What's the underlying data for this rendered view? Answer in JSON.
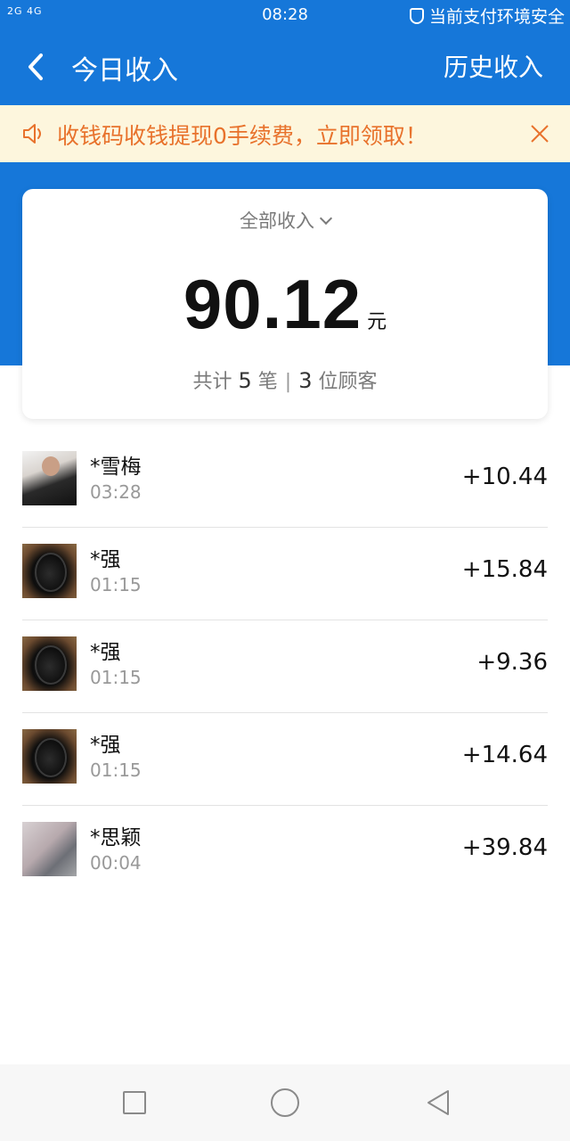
{
  "status_bar": {
    "signal": "2G 4G",
    "time": "08:28",
    "security_text": "当前支付环境安全"
  },
  "header": {
    "title": "今日收入",
    "history_label": "历史收入"
  },
  "notice": {
    "text": "收钱码收钱提现0手续费，立即领取！"
  },
  "summary": {
    "filter_label": "全部收入",
    "amount": "90.12",
    "unit": "元",
    "count_prefix": "共计",
    "count": "5",
    "count_suffix": "笔",
    "separator": "|",
    "customers": "3",
    "customers_suffix": "位顾客"
  },
  "transactions": [
    {
      "name": "*雪梅",
      "time": "03:28",
      "amount": "+10.44"
    },
    {
      "name": "*强",
      "time": "01:15",
      "amount": "+15.84"
    },
    {
      "name": "*强",
      "time": "01:15",
      "amount": "+9.36"
    },
    {
      "name": "*强",
      "time": "01:15",
      "amount": "+14.64"
    },
    {
      "name": "*思颖",
      "time": "00:04",
      "amount": "+39.84"
    }
  ],
  "colors": {
    "primary": "#1677d9",
    "notice_bg": "#fdf6dd",
    "notice_text": "#e8722c"
  }
}
